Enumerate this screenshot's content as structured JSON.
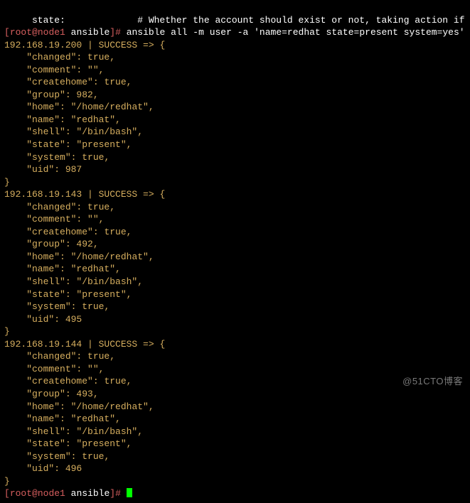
{
  "header_partial": "     state:             # Whether the account should exist or not, taking action if the s",
  "prompt": {
    "user": "root",
    "host": "node1",
    "dir": "ansible",
    "cmd": "ansible all -m user -a 'name=redhat state=present system=yes'"
  },
  "results": [
    {
      "ip": "192.168.19.200",
      "status": "SUCCESS",
      "fields": {
        "changed": "true",
        "comment": "\"\"",
        "createhome": "true",
        "group": "982",
        "home": "\"/home/redhat\"",
        "name": "\"redhat\"",
        "shell": "\"/bin/bash\"",
        "state": "\"present\"",
        "system": "true",
        "uid": "987"
      }
    },
    {
      "ip": "192.168.19.143",
      "status": "SUCCESS",
      "fields": {
        "changed": "true",
        "comment": "\"\"",
        "createhome": "true",
        "group": "492",
        "home": "\"/home/redhat\"",
        "name": "\"redhat\"",
        "shell": "\"/bin/bash\"",
        "state": "\"present\"",
        "system": "true",
        "uid": "495"
      }
    },
    {
      "ip": "192.168.19.144",
      "status": "SUCCESS",
      "fields": {
        "changed": "true",
        "comment": "\"\"",
        "createhome": "true",
        "group": "493",
        "home": "\"/home/redhat\"",
        "name": "\"redhat\"",
        "shell": "\"/bin/bash\"",
        "state": "\"present\"",
        "system": "true",
        "uid": "496"
      }
    }
  ],
  "tail_prompt": {
    "user": "root",
    "host": "node1",
    "dir": "ansible"
  },
  "watermark": "@51CTO博客"
}
